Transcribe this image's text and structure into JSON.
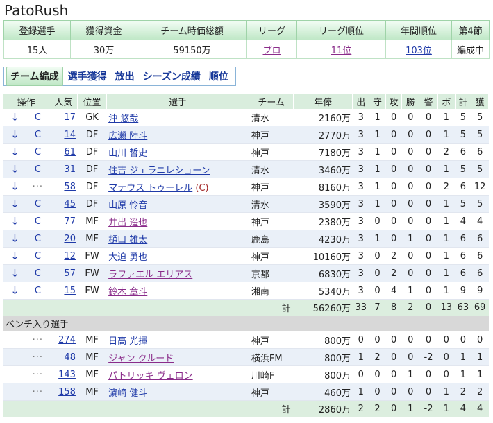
{
  "app_title": "PatoRush",
  "summary": {
    "headers": [
      "登録選手",
      "獲得資金",
      "チーム時価総額",
      "リーグ",
      "リーグ順位",
      "年間順位",
      "第4節"
    ],
    "values": [
      "15人",
      "30万",
      "59150万",
      "プロ",
      "11位",
      "103位",
      "編成中"
    ]
  },
  "tabs": [
    "チーム編成",
    "選手獲得",
    "放出",
    "シーズン成績",
    "順位"
  ],
  "roster": {
    "headers": [
      "操作",
      "人気",
      "位置",
      "選手",
      "チーム",
      "年俸",
      "出",
      "守",
      "攻",
      "勝",
      "警",
      "ボ",
      "計",
      "獲"
    ],
    "starters": [
      {
        "op1": "↓",
        "op2": "C",
        "pop": "17",
        "pos": "GK",
        "name": "沖 悠哉",
        "cap": "",
        "team": "清水",
        "salary": "2160万",
        "s": [
          "3",
          "1",
          "0",
          "0",
          "0",
          "1",
          "5",
          "5"
        ],
        "style": "blue"
      },
      {
        "op1": "↓",
        "op2": "C",
        "pop": "14",
        "pos": "DF",
        "name": "広瀬 陸斗",
        "cap": "",
        "team": "神戸",
        "salary": "2770万",
        "s": [
          "3",
          "1",
          "0",
          "0",
          "0",
          "1",
          "5",
          "5"
        ],
        "style": "blue"
      },
      {
        "op1": "↓",
        "op2": "C",
        "pop": "61",
        "pos": "DF",
        "name": "山川 哲史",
        "cap": "",
        "team": "神戸",
        "salary": "7180万",
        "s": [
          "3",
          "1",
          "0",
          "0",
          "0",
          "2",
          "6",
          "6"
        ],
        "style": "blue"
      },
      {
        "op1": "↓",
        "op2": "C",
        "pop": "31",
        "pos": "DF",
        "name": "住吉 ジェラニレショーン",
        "cap": "",
        "team": "清水",
        "salary": "3460万",
        "s": [
          "3",
          "1",
          "0",
          "0",
          "0",
          "1",
          "5",
          "5"
        ],
        "style": "blue"
      },
      {
        "op1": "↓",
        "op2": "···",
        "pop": "58",
        "pos": "DF",
        "name": "マテウス トゥーレル",
        "cap": "(C)",
        "team": "神戸",
        "salary": "8160万",
        "s": [
          "3",
          "1",
          "0",
          "0",
          "0",
          "2",
          "6",
          "12"
        ],
        "style": "blue"
      },
      {
        "op1": "↓",
        "op2": "C",
        "pop": "45",
        "pos": "DF",
        "name": "山原 怜音",
        "cap": "",
        "team": "清水",
        "salary": "3590万",
        "s": [
          "3",
          "1",
          "0",
          "0",
          "0",
          "1",
          "5",
          "5"
        ],
        "style": "blue"
      },
      {
        "op1": "↓",
        "op2": "C",
        "pop": "77",
        "pos": "MF",
        "name": "井出 遥也",
        "cap": "",
        "team": "神戸",
        "salary": "2380万",
        "s": [
          "3",
          "0",
          "0",
          "0",
          "0",
          "1",
          "4",
          "4"
        ],
        "style": "violet"
      },
      {
        "op1": "↓",
        "op2": "C",
        "pop": "20",
        "pos": "MF",
        "name": "樋口 雄太",
        "cap": "",
        "team": "鹿島",
        "salary": "4230万",
        "s": [
          "3",
          "1",
          "0",
          "1",
          "0",
          "1",
          "6",
          "6"
        ],
        "style": "blue"
      },
      {
        "op1": "↓",
        "op2": "C",
        "pop": "12",
        "pos": "FW",
        "name": "大迫 勇也",
        "cap": "",
        "team": "神戸",
        "salary": "10160万",
        "s": [
          "3",
          "0",
          "2",
          "0",
          "0",
          "1",
          "6",
          "6"
        ],
        "style": "blue"
      },
      {
        "op1": "↓",
        "op2": "C",
        "pop": "57",
        "pos": "FW",
        "name": "ラファエル エリアス",
        "cap": "",
        "team": "京都",
        "salary": "6830万",
        "s": [
          "3",
          "0",
          "2",
          "0",
          "0",
          "1",
          "6",
          "6"
        ],
        "style": "violet"
      },
      {
        "op1": "↓",
        "op2": "C",
        "pop": "15",
        "pos": "FW",
        "name": "鈴木 章斗",
        "cap": "",
        "team": "湘南",
        "salary": "5340万",
        "s": [
          "3",
          "0",
          "4",
          "1",
          "0",
          "1",
          "9",
          "9"
        ],
        "style": "violet"
      }
    ],
    "starters_total": {
      "label": "計",
      "salary": "56260万",
      "s": [
        "33",
        "7",
        "8",
        "2",
        "0",
        "13",
        "63",
        "69"
      ]
    },
    "bench_label": "ベンチ入り選手",
    "bench": [
      {
        "op1": "",
        "op2": "···",
        "pop": "274",
        "pos": "MF",
        "name": "日高 光揮",
        "cap": "",
        "team": "神戸",
        "salary": "800万",
        "s": [
          "0",
          "0",
          "0",
          "0",
          "0",
          "0",
          "0",
          "0"
        ],
        "style": "blue"
      },
      {
        "op1": "",
        "op2": "···",
        "pop": "48",
        "pos": "MF",
        "name": "ジャン クルード",
        "cap": "",
        "team": "横浜FM",
        "salary": "800万",
        "s": [
          "1",
          "2",
          "0",
          "0",
          "-2",
          "0",
          "1",
          "1"
        ],
        "style": "violet"
      },
      {
        "op1": "",
        "op2": "···",
        "pop": "143",
        "pos": "MF",
        "name": "パトリッキ ヴェロン",
        "cap": "",
        "team": "川崎F",
        "salary": "800万",
        "s": [
          "0",
          "0",
          "0",
          "1",
          "0",
          "0",
          "1",
          "1"
        ],
        "style": "violet"
      },
      {
        "op1": "",
        "op2": "···",
        "pop": "158",
        "pos": "MF",
        "name": "濵崎 健斗",
        "cap": "",
        "team": "神戸",
        "salary": "460万",
        "s": [
          "1",
          "0",
          "0",
          "0",
          "0",
          "1",
          "2",
          "2"
        ],
        "style": "blue"
      }
    ],
    "bench_total": {
      "label": "計",
      "salary": "2860万",
      "s": [
        "2",
        "2",
        "0",
        "1",
        "-2",
        "1",
        "4",
        "4"
      ]
    }
  }
}
